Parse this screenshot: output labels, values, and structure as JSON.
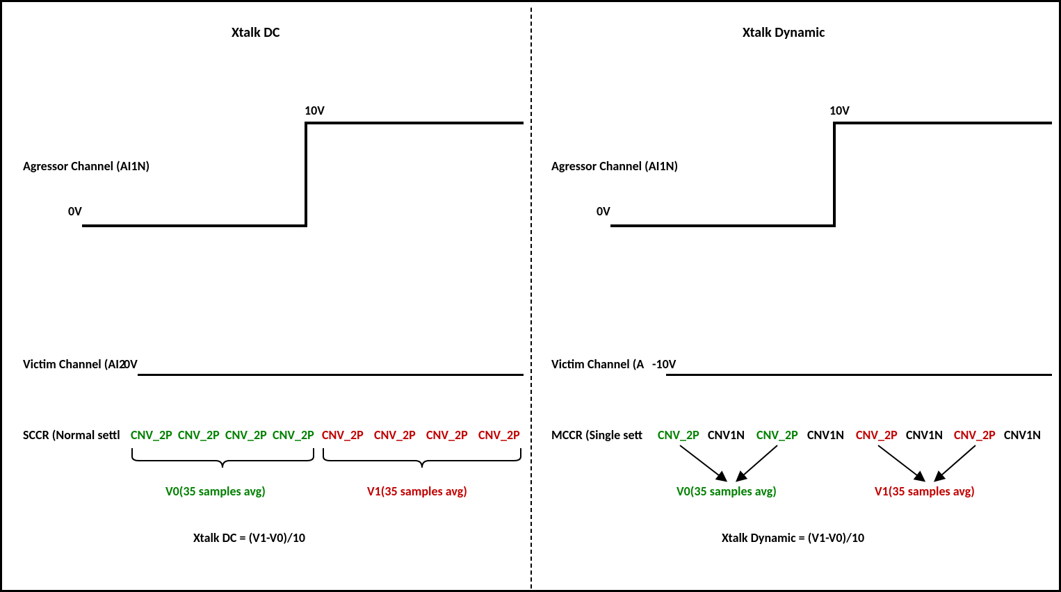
{
  "left": {
    "title": "Xtalk DC",
    "agg_label": "Agressor Channel (AI1N)",
    "agg_0v": "0V",
    "agg_10v": "10V",
    "victim_label": "Victim Channel (AI2",
    "victim_v": "0V",
    "sccr_prefix": "SCCR (Normal settl",
    "cnv_g": "CNV_2P",
    "cnv_r": "CNV_2P",
    "v0": "V0(35 samples avg)",
    "v1": "V1(35 samples avg)",
    "formula": "Xtalk DC = (V1-V0)/10"
  },
  "right": {
    "title": "Xtalk Dynamic",
    "agg_label": "Agressor Channel (AI1N)",
    "agg_0v": "0V",
    "agg_10v": "10V",
    "victim_label": "Victim Channel (A",
    "victim_v": "-10V",
    "mccr_prefix": "MCCR (Single sett",
    "cnv2p": "CNV_2P",
    "cnv1n": "CNV1N",
    "v0": "V0(35 samples avg)",
    "v1": "V1(35 samples avg)",
    "formula": "Xtalk Dynamic = (V1-V0)/10"
  }
}
